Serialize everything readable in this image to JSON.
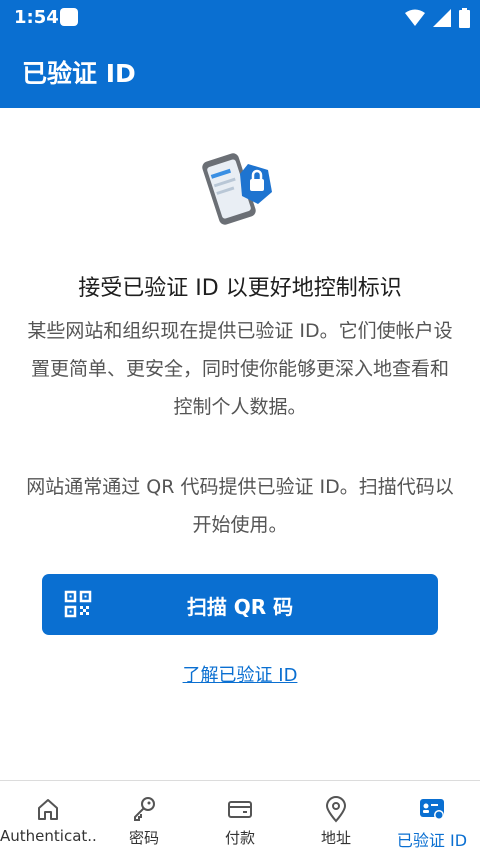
{
  "status_bar": {
    "time": "1:54"
  },
  "app_bar": {
    "title": "已验证 ID"
  },
  "main": {
    "heading": "接受已验证 ID 以更好地控制标识",
    "paragraph1": "某些网站和组织现在提供已验证 ID。它们使帐户设置更简单、更安全，同时使你能够更深入地查看和控制个人数据。",
    "paragraph2": "网站通常通过 QR 代码提供已验证 ID。扫描代码以开始使用。",
    "scan_button": "扫描 QR 码",
    "learn_link": "了解已验证 ID"
  },
  "bottom_nav": {
    "items": [
      {
        "label": "Authenticat...",
        "icon": "home-icon"
      },
      {
        "label": "密码",
        "icon": "key-icon"
      },
      {
        "label": "付款",
        "icon": "card-icon"
      },
      {
        "label": "地址",
        "icon": "location-pin-icon"
      },
      {
        "label": "已验证 ID",
        "icon": "verified-id-icon",
        "active": true
      }
    ]
  },
  "colors": {
    "accent": "#0a6fd1",
    "text": "#1e1e1e",
    "muted": "#555555"
  }
}
